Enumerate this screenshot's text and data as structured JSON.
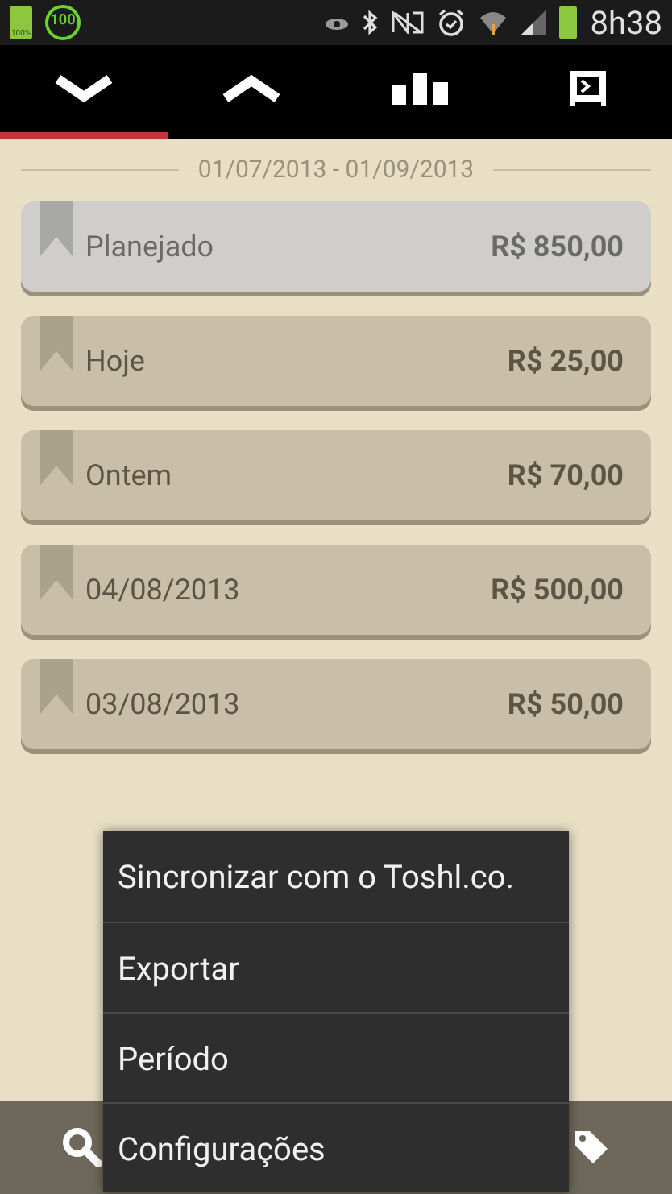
{
  "status_bar": {
    "battery_label": "100%",
    "badge": "100",
    "time": "8h38"
  },
  "tabs": [
    {
      "kind": "collapse",
      "selected": true
    },
    {
      "kind": "expand",
      "selected": false
    },
    {
      "kind": "chart",
      "selected": false
    },
    {
      "kind": "export",
      "selected": false
    }
  ],
  "period": "01/07/2013 - 01/09/2013",
  "rows": [
    {
      "label": "Planejado",
      "amount": "R$ 850,00",
      "selected": true
    },
    {
      "label": "Hoje",
      "amount": "R$ 25,00",
      "selected": false
    },
    {
      "label": "Ontem",
      "amount": "R$ 70,00",
      "selected": false
    },
    {
      "label": "04/08/2013",
      "amount": "R$ 500,00",
      "selected": false
    },
    {
      "label": "03/08/2013",
      "amount": "R$ 50,00",
      "selected": false
    }
  ],
  "menu": [
    "Sincronizar com o Toshl.co.",
    "Exportar",
    "Período",
    "Configurações"
  ]
}
